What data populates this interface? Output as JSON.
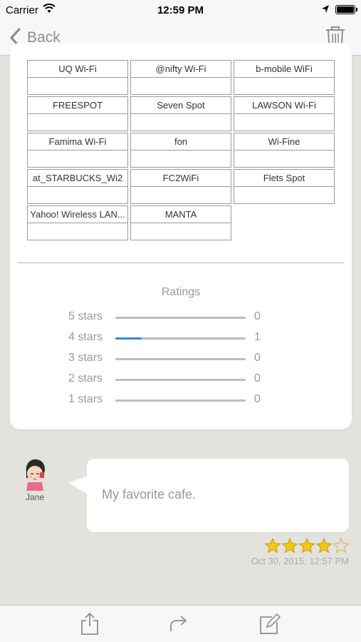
{
  "status_bar": {
    "carrier": "Carrier",
    "time": "12:59 PM",
    "icons": [
      "wifi-icon",
      "location-arrow-icon",
      "battery-icon"
    ]
  },
  "nav": {
    "back_label": "Back",
    "back_icon": "chevron-left-icon",
    "trash_icon": "trash-icon",
    "icon_color": "#8e8e93"
  },
  "wifi_services": [
    "UQ Wi-Fi",
    "@nifty Wi-Fi",
    "b-mobile WiFi",
    "FREESPOT",
    "Seven Spot",
    "LAWSON Wi-Fi",
    "Famima Wi-Fi",
    "fon",
    "Wi-Fine",
    "at_STARBUCKS_Wi2",
    "FC2WiFi",
    "Flets Spot",
    "Yahoo! Wireless LAN...",
    "MANTA"
  ],
  "ratings": {
    "title": "Ratings",
    "rows": [
      {
        "label": "5 stars",
        "count": "0",
        "fraction": 0
      },
      {
        "label": "4 stars",
        "count": "1",
        "fraction": 0.2
      },
      {
        "label": "3 stars",
        "count": "0",
        "fraction": 0
      },
      {
        "label": "2 stars",
        "count": "0",
        "fraction": 0
      },
      {
        "label": "1 stars",
        "count": "0",
        "fraction": 0
      }
    ],
    "bar_color": "#3a84d8"
  },
  "review": {
    "user_name": "Jane",
    "text": "My favorite cafe.",
    "stars": 4,
    "max_stars": 5,
    "date": "Oct 30, 2015, 12:57 PM",
    "star_color": "#f5c518"
  },
  "toolbar": {
    "icons": [
      "share-icon",
      "forward-icon",
      "compose-icon"
    ]
  }
}
